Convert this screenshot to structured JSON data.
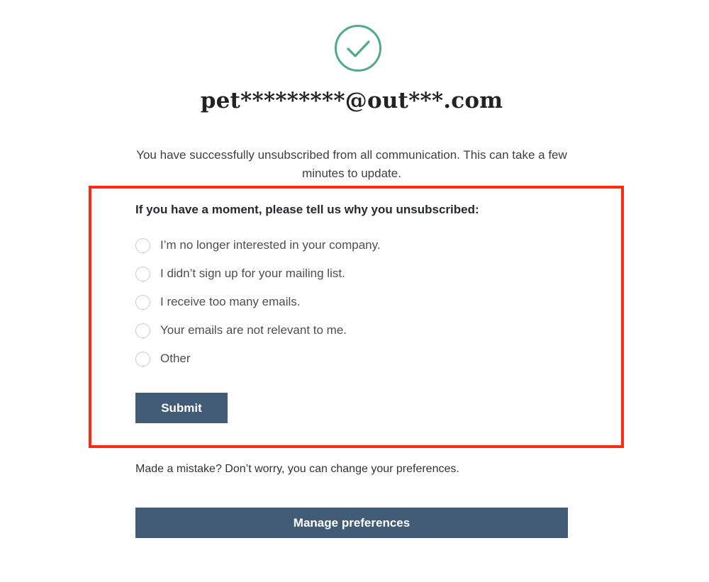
{
  "status_icon": {
    "name": "check-circle-icon",
    "color": "#4faa8c"
  },
  "email_masked": "pet*********@out***.com",
  "success_message": "You have successfully unsubscribed from all communication. This can take a few minutes to update.",
  "survey": {
    "question": "If you have a moment, please tell us why you unsubscribed:",
    "highlight_color": "#ff2a12",
    "reasons": [
      {
        "label": "I’m no longer interested in your company.",
        "selected": false
      },
      {
        "label": "I didn’t sign up for your mailing list.",
        "selected": false
      },
      {
        "label": "I receive too many emails.",
        "selected": false
      },
      {
        "label": "Your emails are not relevant to me.",
        "selected": false
      },
      {
        "label": "Other",
        "selected": false
      }
    ],
    "submit_label": "Submit"
  },
  "mistake_message": "Made a mistake? Don’t worry, you can change your preferences.",
  "manage_preferences_label": "Manage preferences",
  "button_color": "#425b76"
}
